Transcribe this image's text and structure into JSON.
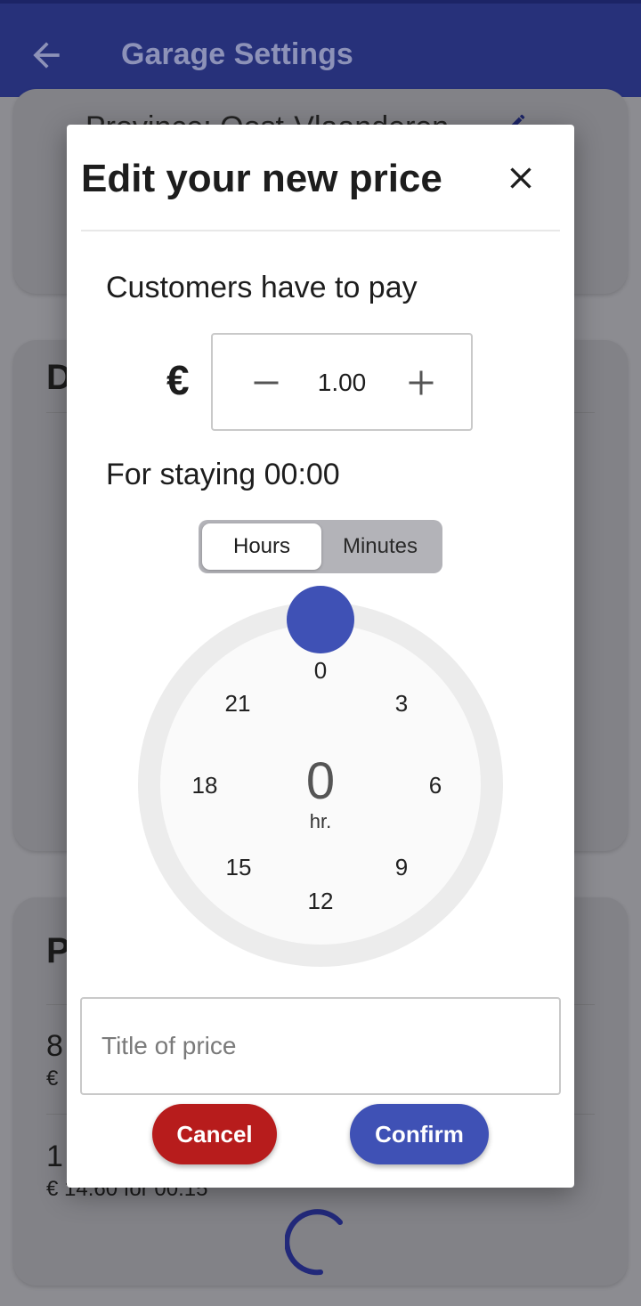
{
  "appbar": {
    "title": "Garage Settings",
    "back_icon": "back-arrow-icon",
    "bg": "#27317a"
  },
  "background": {
    "province_text": "Province: Oost-Vlaanderen",
    "section_d_initial": "D",
    "section_p_initial": "P",
    "rows": [
      {
        "title": "8",
        "subtitle": "€"
      },
      {
        "title": "1",
        "subtitle": "€ 14.60 for 00:15"
      }
    ]
  },
  "dialog": {
    "title": "Edit your new price",
    "close_icon": "close-icon",
    "customers_label": "Customers have to pay",
    "currency": "€",
    "price_value": "1.00",
    "staying_label": "For staying 00:00",
    "toggle": {
      "hours": "Hours",
      "minutes": "Minutes",
      "selected": "Hours"
    },
    "clock": {
      "numbers": [
        "0",
        "3",
        "6",
        "9",
        "12",
        "15",
        "18",
        "21"
      ],
      "selected_value": "0",
      "unit": "hr.",
      "accent": "#3f51b5"
    },
    "title_field": {
      "placeholder": "Title of price",
      "value": ""
    },
    "cancel_label": "Cancel",
    "confirm_label": "Confirm",
    "cancel_color": "#b71c1c",
    "confirm_color": "#3f51b5"
  }
}
